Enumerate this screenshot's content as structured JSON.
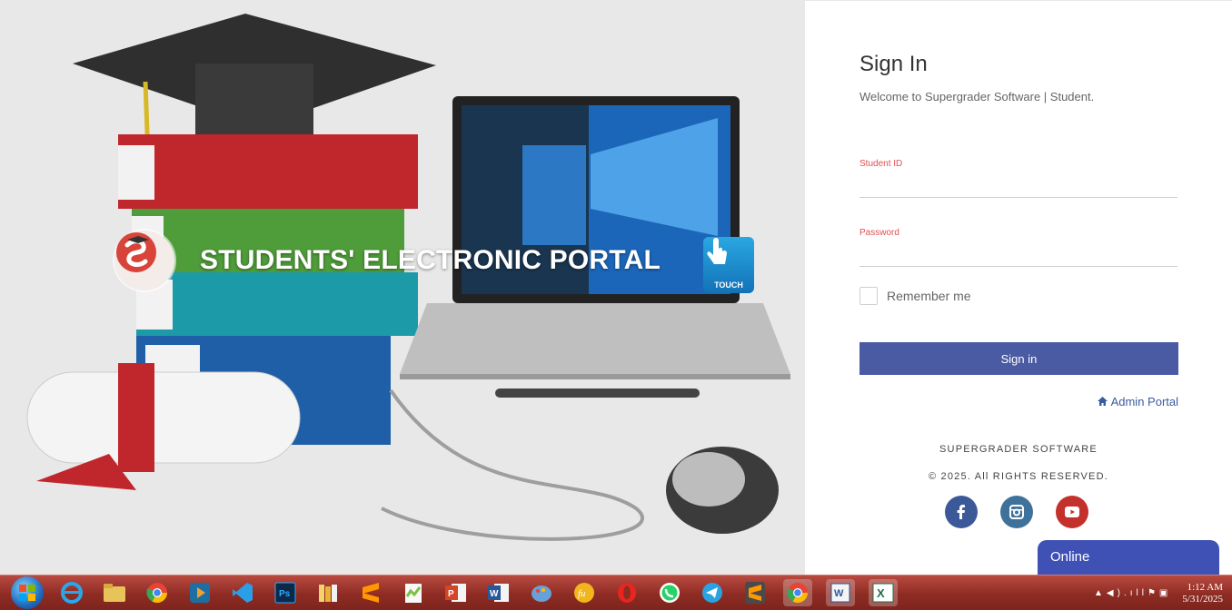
{
  "hero": {
    "title": "STUDENTS' ELECTRONIC PORTAL",
    "touch_label": "TOUCH"
  },
  "signin": {
    "title": "Sign In",
    "subtitle": "Welcome to Supergrader Software | Student.",
    "student_id_label": "Student ID",
    "password_label": "Password",
    "remember_label": "Remember me",
    "button_label": "Sign in",
    "admin_link": "Admin Portal"
  },
  "footer": {
    "company": "SUPERGRADER SOFTWARE",
    "rights": "© 2025. All RIGHTS RESERVED."
  },
  "social": [
    "facebook-icon",
    "instagram-icon",
    "youtube-icon"
  ],
  "chat": {
    "label": "Online"
  },
  "taskbar": {
    "apps": [
      "internet-explorer",
      "file-explorer",
      "chrome",
      "media-player",
      "vs-code",
      "photoshop",
      "library",
      "sublime-text",
      "notepad-plus",
      "powerpoint",
      "word",
      "paint",
      "fujitsu",
      "opera",
      "whatsapp",
      "telegram",
      "sublime-text",
      "chrome",
      "word-document",
      "excel-like"
    ],
    "time": "1:12 AM",
    "date": "5/31/2025"
  },
  "colors": {
    "primary": "#4a5aa3",
    "label_red": "#e05050",
    "chat": "#3f51b5",
    "taskbar": "#8e2c24"
  }
}
